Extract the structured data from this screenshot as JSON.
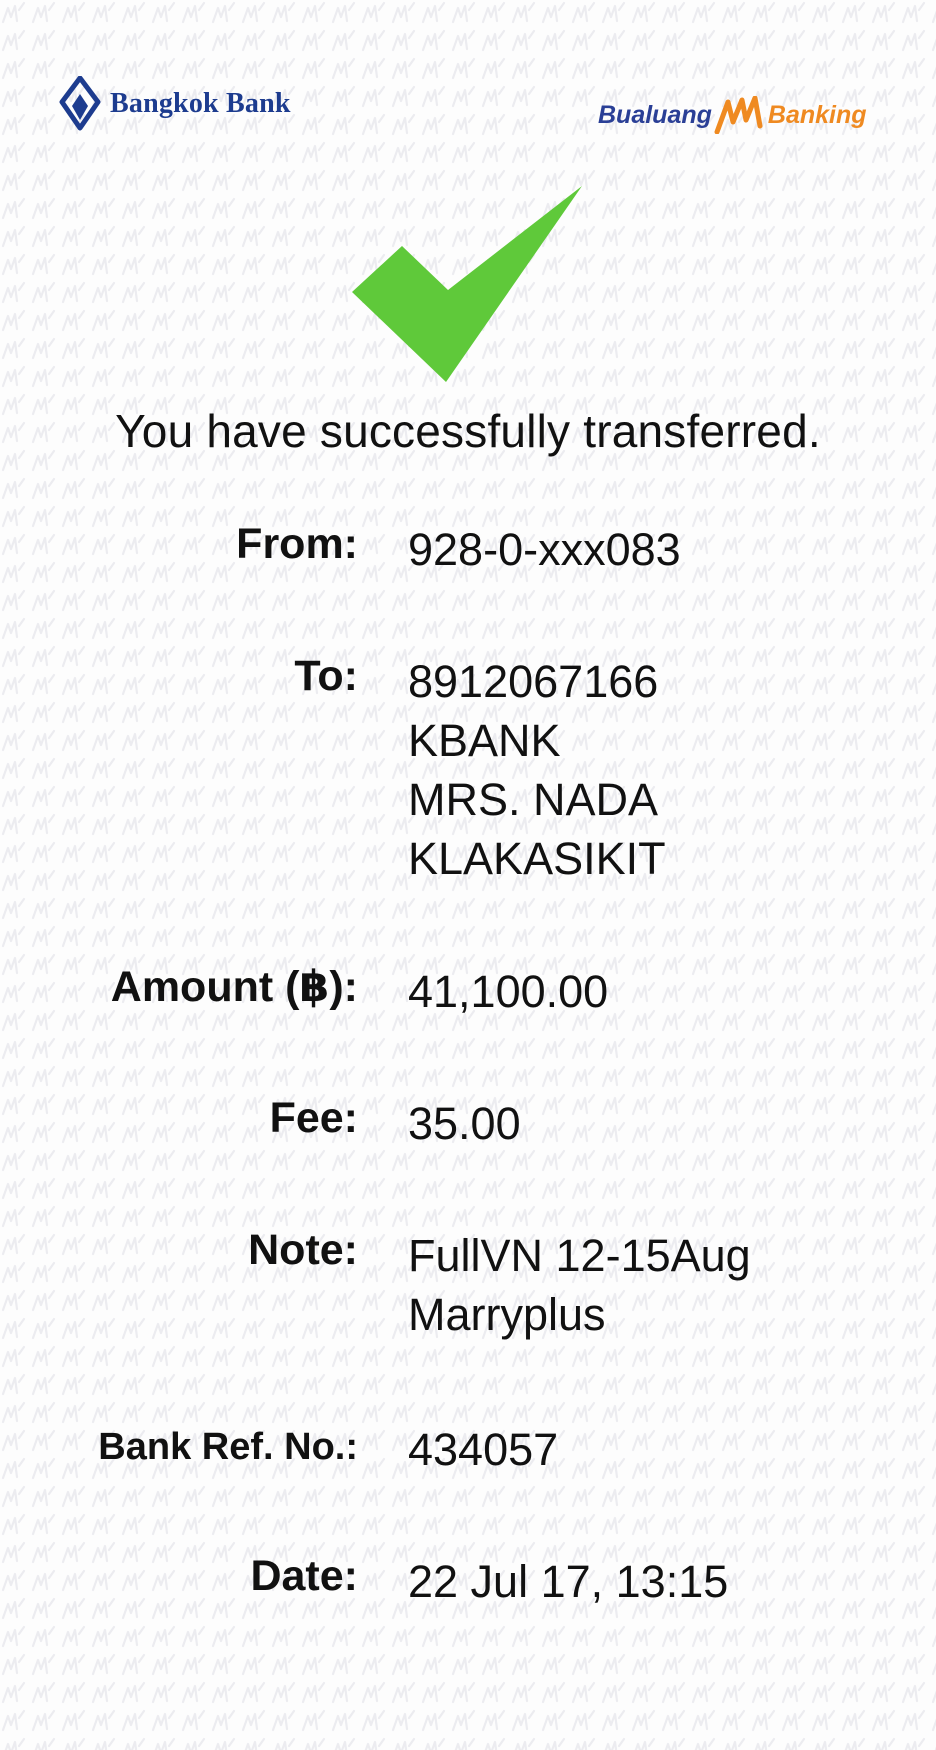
{
  "header": {
    "bank_name": "Bangkok Bank",
    "app_brand": {
      "prefix": "Bualuang",
      "suffix": "Banking"
    },
    "colors": {
      "bank_blue": "#1d3c8f",
      "brand_orange": "#ef8a21",
      "check_green": "#5fc93a"
    }
  },
  "status": {
    "icon": "checkmark-icon",
    "message": "You have successfully transferred."
  },
  "details": {
    "from": {
      "label": "From:",
      "value": "928-0-xxx083"
    },
    "to": {
      "label": "To:",
      "account": "8912067166",
      "bank": "KBANK",
      "name_line1": "MRS. NADA",
      "name_line2": "KLAKASIKIT"
    },
    "amount": {
      "label": "Amount (฿):",
      "value": "41,100.00"
    },
    "fee": {
      "label": "Fee:",
      "value": "35.00"
    },
    "note": {
      "label": "Note:",
      "line1": "FullVN 12-15Aug",
      "line2": "Marryplus"
    },
    "ref": {
      "label": "Bank Ref. No.:",
      "value": "434057"
    },
    "date": {
      "label": "Date:",
      "value": "22 Jul 17, 13:15"
    }
  }
}
